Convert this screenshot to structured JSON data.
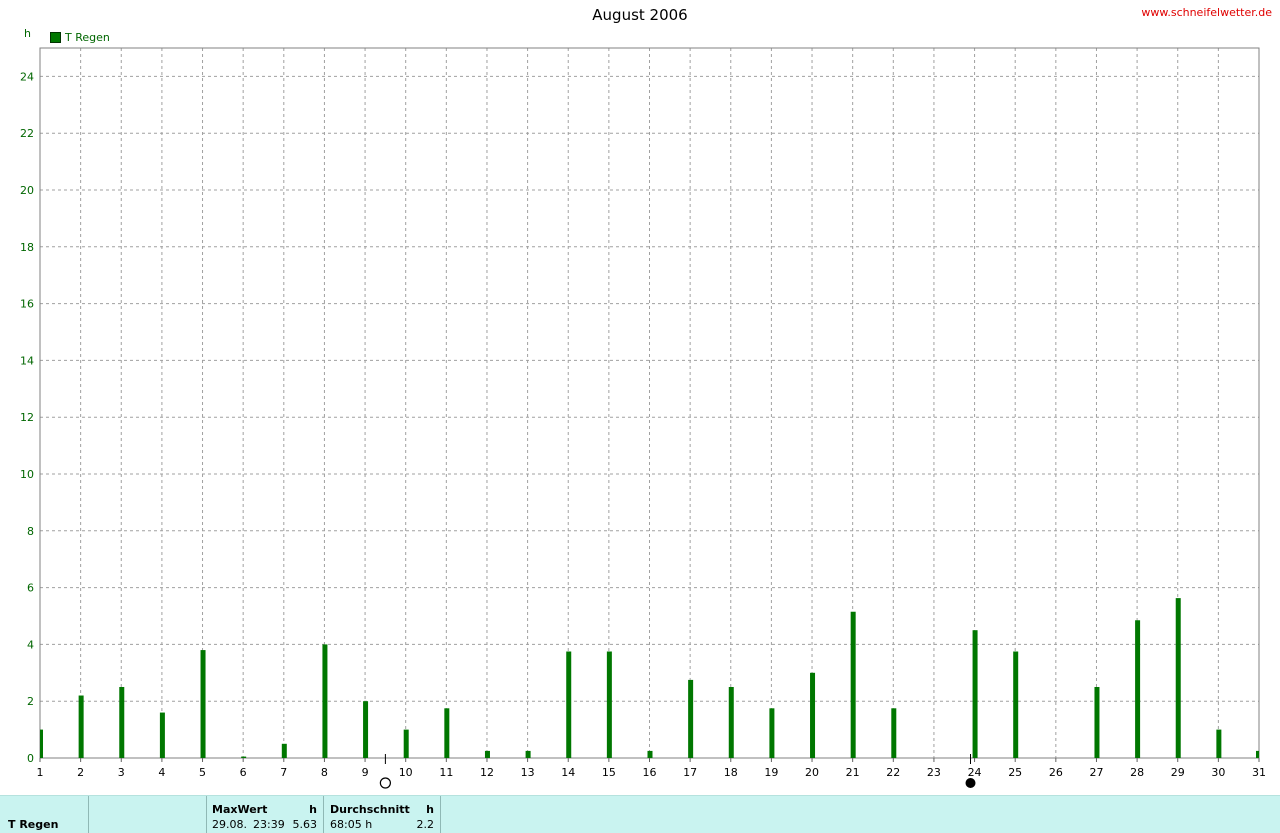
{
  "header": {
    "title": "August 2006",
    "site": "www.schneifelwetter.de",
    "unit": "h"
  },
  "chart_data": {
    "type": "bar",
    "title": "August 2006",
    "ylabel": "h",
    "xlabel": "",
    "xlim": [
      1,
      31
    ],
    "ylim": [
      0,
      25
    ],
    "yticks": [
      0,
      2,
      4,
      6,
      8,
      10,
      12,
      14,
      16,
      18,
      20,
      22,
      24
    ],
    "categories": [
      "1",
      "2",
      "3",
      "4",
      "5",
      "6",
      "7",
      "8",
      "9",
      "10",
      "11",
      "12",
      "13",
      "14",
      "15",
      "16",
      "17",
      "18",
      "19",
      "20",
      "21",
      "22",
      "23",
      "24",
      "25",
      "26",
      "27",
      "28",
      "29",
      "30",
      "31"
    ],
    "grid": true,
    "legend": "top-left",
    "series": [
      {
        "name": "T Regen",
        "color": "#007700",
        "values": [
          1.0,
          2.2,
          2.5,
          1.6,
          3.8,
          0.05,
          0.5,
          4.0,
          2.0,
          1.0,
          1.75,
          0.25,
          0.25,
          3.75,
          3.75,
          0.25,
          2.75,
          2.5,
          1.75,
          3.0,
          5.15,
          1.75,
          0.0,
          4.5,
          3.75,
          0.0,
          2.5,
          4.85,
          5.63,
          1.0,
          0.25
        ]
      }
    ],
    "moon_phases": [
      {
        "phase": "full-moon",
        "day": 9.5
      },
      {
        "phase": "new-moon",
        "day": 23.9
      }
    ]
  },
  "stats": {
    "series_name": "T Regen",
    "max_header": "MaxWert",
    "max_unit": "h",
    "max_date": "29.08.",
    "max_time": "23:39",
    "max_value": "5.63",
    "avg_header": "Durchschnitt",
    "avg_unit": "h",
    "avg_total": "68:05 h",
    "avg_value": "2.2"
  }
}
